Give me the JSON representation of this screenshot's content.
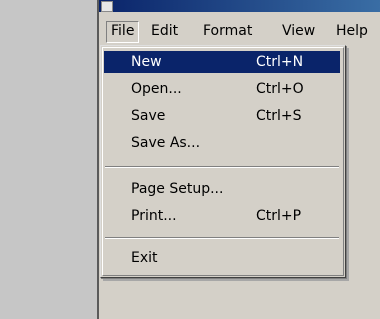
{
  "menubar": {
    "file": "File",
    "edit": "Edit",
    "format": "Format",
    "view": "View",
    "help": "Help"
  },
  "file_menu": {
    "items": [
      {
        "label": "New",
        "shortcut": "Ctrl+N"
      },
      {
        "label": "Open...",
        "shortcut": "Ctrl+O"
      },
      {
        "label": "Save",
        "shortcut": "Ctrl+S"
      },
      {
        "label": "Save As...",
        "shortcut": ""
      },
      {
        "label": "Page Setup...",
        "shortcut": ""
      },
      {
        "label": "Print...",
        "shortcut": "Ctrl+P"
      },
      {
        "label": "Exit",
        "shortcut": ""
      }
    ]
  },
  "colors": {
    "highlight": "#0a246a",
    "face": "#d4d0c8"
  },
  "icons": {
    "app": "notepad-icon"
  }
}
